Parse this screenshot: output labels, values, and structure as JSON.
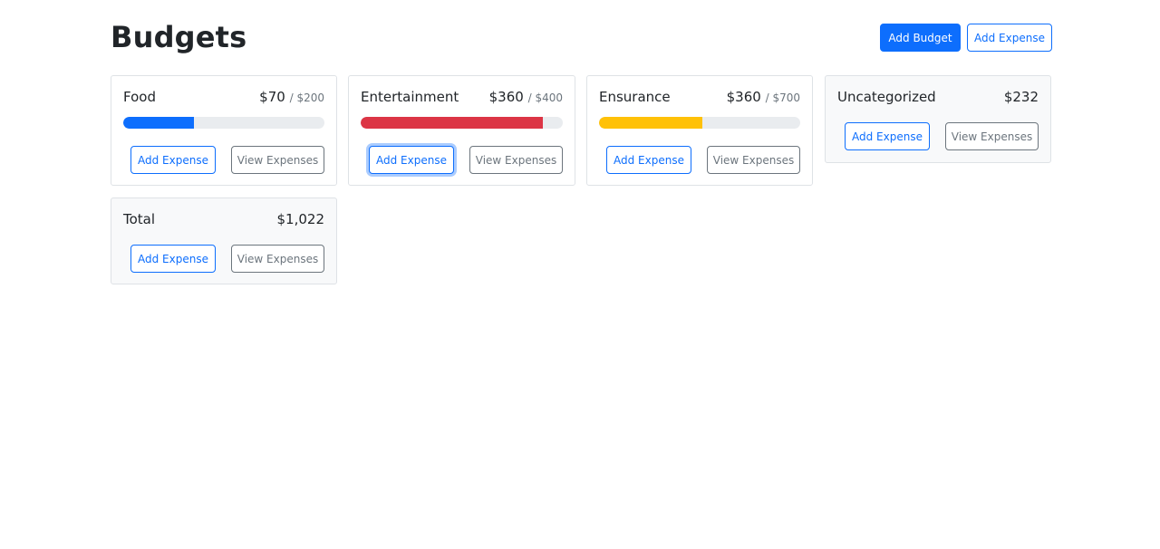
{
  "page": {
    "title": "Budgets"
  },
  "header": {
    "add_budget_label": "Add Budget",
    "add_expense_label": "Add Expense"
  },
  "colors": {
    "primary": "#0d6efd",
    "danger": "#dc3545",
    "warning": "#ffc107",
    "track": "#e9ecef"
  },
  "budgets": [
    {
      "name": "Food",
      "amount": "$70",
      "max": "/ $200",
      "progress": 0.35,
      "color": "#0d6efd",
      "add_label": "Add Expense",
      "view_label": "View Expenses"
    },
    {
      "name": "Entertainment",
      "amount": "$360",
      "max": "/ $400",
      "progress": 0.9,
      "color": "#dc3545",
      "add_label": "Add Expense",
      "view_label": "View Expenses"
    },
    {
      "name": "Ensurance",
      "amount": "$360",
      "max": "/ $700",
      "progress": 0.514,
      "color": "#ffc107",
      "add_label": "Add Expense",
      "view_label": "View Expenses"
    }
  ],
  "uncategorized": {
    "name": "Uncategorized",
    "amount": "$232",
    "add_label": "Add Expense",
    "view_label": "View Expenses"
  },
  "total": {
    "name": "Total",
    "amount": "$1,022",
    "add_label": "Add Expense",
    "view_label": "View Expenses"
  }
}
